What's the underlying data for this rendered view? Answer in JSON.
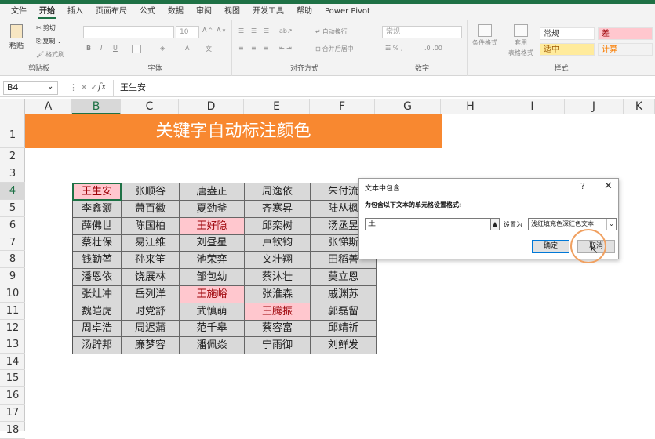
{
  "menu": {
    "tabs": [
      "文件",
      "开始",
      "插入",
      "页面布局",
      "公式",
      "数据",
      "审阅",
      "视图",
      "开发工具",
      "帮助",
      "Power Pivot"
    ],
    "active_index": 1
  },
  "ribbon": {
    "clipboard": {
      "paste": "粘贴",
      "cut": "剪切",
      "copy": "复制",
      "format_painter": "格式刷",
      "label": "剪贴板"
    },
    "font": {
      "size": "10",
      "label": "字体"
    },
    "alignment": {
      "wrap": "自动换行",
      "merge": "合并后居中",
      "label": "对齐方式"
    },
    "number": {
      "format": "常规",
      "label": "数字"
    },
    "styles": {
      "conditional": "条件格式",
      "table_format_1": "套用",
      "table_format_2": "表格格式",
      "normal": "常规",
      "bad": "差",
      "neutral": "适中",
      "calculation": "计算",
      "label": "样式"
    },
    "colors": {
      "accent": "#1e7145",
      "bad_fill": "#ffc7ce",
      "bad_text": "#9c0006"
    }
  },
  "formula_bar": {
    "name_box": "B4",
    "fx": "fx",
    "content": "王生安"
  },
  "columns": [
    "A",
    "B",
    "C",
    "D",
    "E",
    "F",
    "G",
    "H",
    "I",
    "J",
    "K"
  ],
  "rows": [
    "1",
    "2",
    "3",
    "4",
    "5",
    "6",
    "7",
    "8",
    "9",
    "10",
    "11",
    "12",
    "13",
    "14",
    "15",
    "16",
    "17",
    "18"
  ],
  "sheet": {
    "title": "关键字自动标注颜色",
    "table": [
      [
        "王生安",
        "张顺谷",
        "唐盎正",
        "周逸依",
        "朱付流"
      ],
      [
        "李鑫灏",
        "萧百徽",
        "夏劲釜",
        "齐寒昇",
        "陆丛枫"
      ],
      [
        "薛佛世",
        "陈国柏",
        "王好隐",
        "邱栾树",
        "汤丞昱"
      ],
      [
        "蔡壮保",
        "易江维",
        "刘昼星",
        "卢钦钧",
        "张悌斯"
      ],
      [
        "钱勤堃",
        "孙来笙",
        "池荣弈",
        "文壮翔",
        "田稻善"
      ],
      [
        "潘恩依",
        "饶展林",
        "邹包幼",
        "蔡沐壮",
        "莫立恩"
      ],
      [
        "张灶冲",
        "岳列洋",
        "王施峪",
        "张淮森",
        "戚渊苏"
      ],
      [
        "魏皑虎",
        "时党舒",
        "武慎萌",
        "王腾振",
        "郭磊留"
      ],
      [
        "周卓浩",
        "周迟蒲",
        "范千皋",
        "蔡容富",
        "邱靖祈"
      ],
      [
        "汤辟邦",
        "廉梦容",
        "潘佩焱",
        "宁雨御",
        "刘鲜发"
      ]
    ]
  },
  "dialog": {
    "title": "文本中包含",
    "help": "?",
    "close": "✕",
    "prompt": "为包含以下文本的单元格设置格式:",
    "input_value": "王",
    "set_as_label": "设置为",
    "format_value": "浅红填充色深红色文本",
    "ok": "确定",
    "cancel": "取消"
  }
}
